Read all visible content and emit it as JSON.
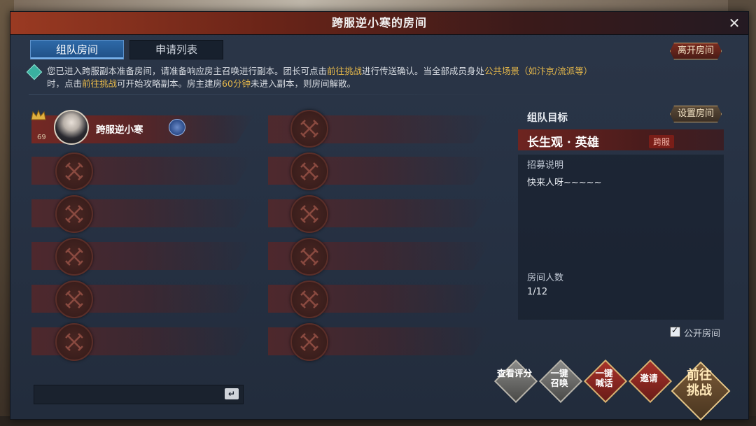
{
  "window": {
    "title": "跨服逆小寒的房间"
  },
  "tabs": [
    {
      "label": "组队房间",
      "active": true
    },
    {
      "label": "申请列表",
      "active": false
    }
  ],
  "buttons": {
    "leave_room": "离开房间",
    "set_room": "设置房间"
  },
  "notice": {
    "part1": "您已进入跨服副本准备房间，请准备响应房主召唤进行副本。团长可点击",
    "link1": "前往挑战",
    "part2": "进行传送确认。当全部成员身处",
    "link2": "公共场景（如汴京/流派等）",
    "part3": "时，点击",
    "link3": "前往挑战",
    "part4": "可开始攻略副本。房主建房",
    "link4": "60分钟",
    "part5": "未进入副本，则房间解散。"
  },
  "members": [
    {
      "name": "跨服逆小寒",
      "level": "69",
      "is_leader": true
    }
  ],
  "team_target": {
    "label": "组队目标",
    "name": "长生观 · 英雄",
    "tag": "跨服",
    "recruit_label": "招募说明",
    "recruit_text": "快来人呀~~~~~",
    "count_label": "房间人数",
    "count_value": "1/12"
  },
  "public_room": {
    "label": "公开房间",
    "checked": true
  },
  "actions": {
    "view_rating": "查看评分",
    "summon_line1": "一键",
    "summon_line2": "召唤",
    "shout_line1": "一键",
    "shout_line2": "喊话",
    "invite": "邀请",
    "go_line1": "前往",
    "go_line2": "挑战"
  },
  "colors": {
    "highlight": "#e6b84a",
    "tab_active": "#2e6aa8",
    "slot_red": "#782822"
  },
  "icons": {
    "empty_slot": "crossed-swords-icon",
    "class": "swirl-class-icon",
    "leader": "crown-icon",
    "notice": "diamond-info-icon",
    "enter": "enter-arrow-icon"
  }
}
